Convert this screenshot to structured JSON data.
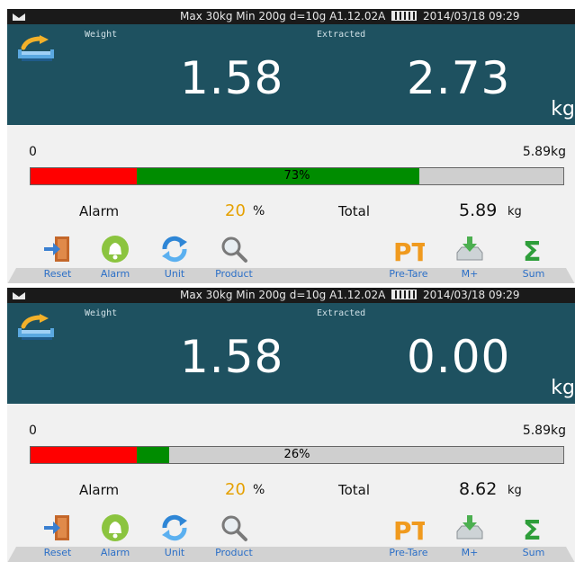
{
  "panels": [
    {
      "status": {
        "info": "Max 30kg  Min 200g  d=10g    A1.12.02A",
        "date": "2014/03/18  09:29"
      },
      "display": {
        "weight_label": "Weight",
        "extracted_label": "Extracted",
        "weight_value": "1.58",
        "extracted_value": "2.73",
        "unit": "kg"
      },
      "scale": {
        "min": "0",
        "max": "5.89kg"
      },
      "progress": {
        "red_fraction": 0.2,
        "fill_fraction": 0.73,
        "label": "73%"
      },
      "alarm": {
        "label": "Alarm",
        "value": "20",
        "unit": "%"
      },
      "total": {
        "label": "Total",
        "value": "5.89",
        "unit": "kg"
      }
    },
    {
      "status": {
        "info": "Max 30kg  Min 200g  d=10g    A1.12.02A",
        "date": "2014/03/18  09:29"
      },
      "display": {
        "weight_label": "Weight",
        "extracted_label": "Extracted",
        "weight_value": "1.58",
        "extracted_value": "0.00",
        "unit": "kg"
      },
      "scale": {
        "min": "0",
        "max": "5.89kg"
      },
      "progress": {
        "red_fraction": 0.2,
        "fill_fraction": 0.26,
        "label": "26%"
      },
      "alarm": {
        "label": "Alarm",
        "value": "20",
        "unit": "%"
      },
      "total": {
        "label": "Total",
        "value": "8.62",
        "unit": "kg"
      }
    }
  ],
  "toolbar": {
    "reset": "Reset",
    "alarm": "Alarm",
    "unit": "Unit",
    "product": "Product",
    "pretare": "Pre-Tare",
    "mplus": "M+",
    "sum": "Sum"
  },
  "icons": {
    "signal": "signal-icon",
    "battery": "battery-icon",
    "tray": "tray-arrow-icon",
    "reset": "door-exit-icon",
    "alarm": "bell-icon",
    "unit": "cycle-arrows-icon",
    "product": "magnifier-icon",
    "pretare": "pt-letters-icon",
    "mplus": "download-tray-icon",
    "sum": "sigma-icon"
  },
  "colors": {
    "display_bg": "#1e5160",
    "alarm_value": "#e5a000",
    "bar_red": "#ff0000",
    "bar_green": "#008c00",
    "button_label": "#2b6fc7"
  }
}
